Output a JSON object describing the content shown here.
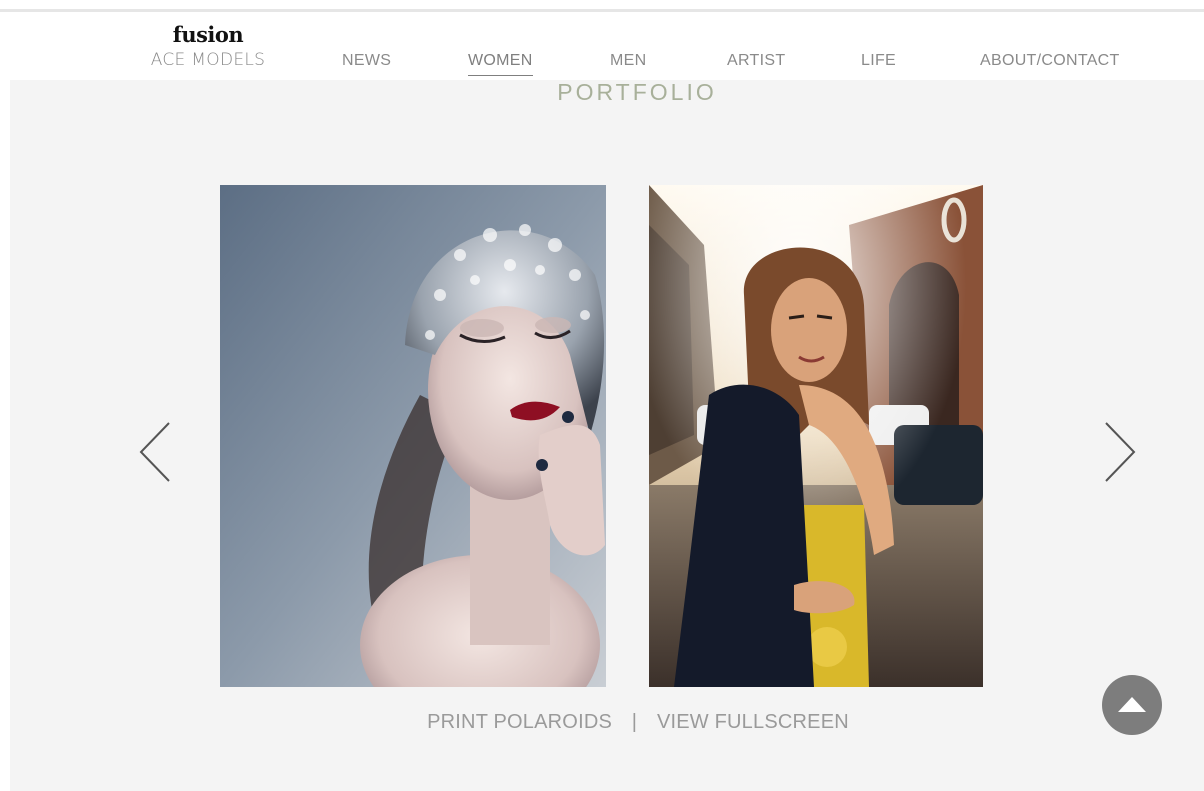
{
  "logo": {
    "mark": "fusion",
    "subtitle": "ACE MODELS"
  },
  "nav": {
    "items": [
      {
        "label": "NEWS",
        "active": false
      },
      {
        "label": "WOMEN",
        "active": true
      },
      {
        "label": "MEN",
        "active": false
      },
      {
        "label": "ARTIST",
        "active": false
      },
      {
        "label": "LIFE",
        "active": false
      },
      {
        "label": "ABOUT/CONTACT",
        "active": false
      }
    ]
  },
  "page": {
    "section_title": "PORTFOLIO"
  },
  "gallery": {
    "photos": [
      {
        "subject": "model-with-jeweled-headpiece"
      },
      {
        "subject": "model-in-city-street"
      }
    ],
    "prev_icon": "chevron-left-icon",
    "next_icon": "chevron-right-icon"
  },
  "footer": {
    "print_label": "PRINT POLAROIDS",
    "separator": "|",
    "fullscreen_label": "VIEW FULLSCREEN"
  },
  "scroll_top": {
    "icon": "arrow-up-icon"
  },
  "colors": {
    "accent_title": "#a8b09a",
    "nav_text": "#8a8a8a",
    "content_bg": "#f4f4f4",
    "scroll_button": "#7d7d7d"
  }
}
